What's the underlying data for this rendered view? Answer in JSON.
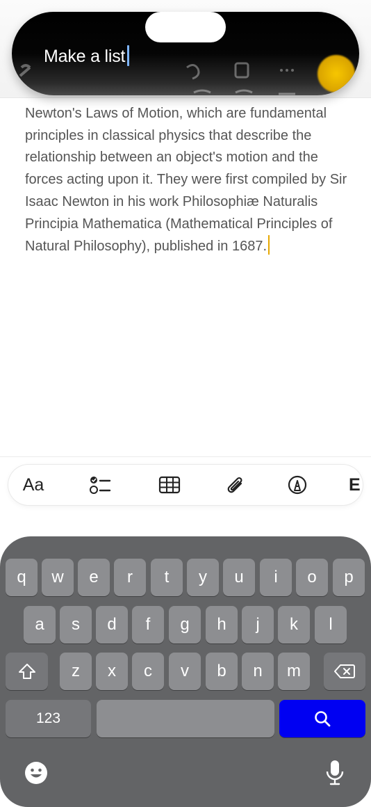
{
  "prompt": {
    "text": "Make a list"
  },
  "note": {
    "body": "Newton's Laws of Motion, which are fundamental principles in classical physics that describe the relationship between an object's motion and the forces acting upon it. They were first compiled by Sir Isaac Newton in his work Philosophiæ Naturalis Principia Mathematica (Mathematical Principles of Natural Philosophy), published in 1687."
  },
  "format_bar": {
    "text_style_label": "Aa",
    "cut_label": "E"
  },
  "keyboard": {
    "row1": [
      "q",
      "w",
      "e",
      "r",
      "t",
      "y",
      "u",
      "i",
      "o",
      "p"
    ],
    "row2": [
      "a",
      "s",
      "d",
      "f",
      "g",
      "h",
      "j",
      "k",
      "l"
    ],
    "row3": [
      "z",
      "x",
      "c",
      "v",
      "b",
      "n",
      "m"
    ],
    "numbers_label": "123"
  },
  "colors": {
    "accent_yellow": "#e7a800",
    "search_key": "#0000f2",
    "keyboard_bg": "#636466"
  }
}
